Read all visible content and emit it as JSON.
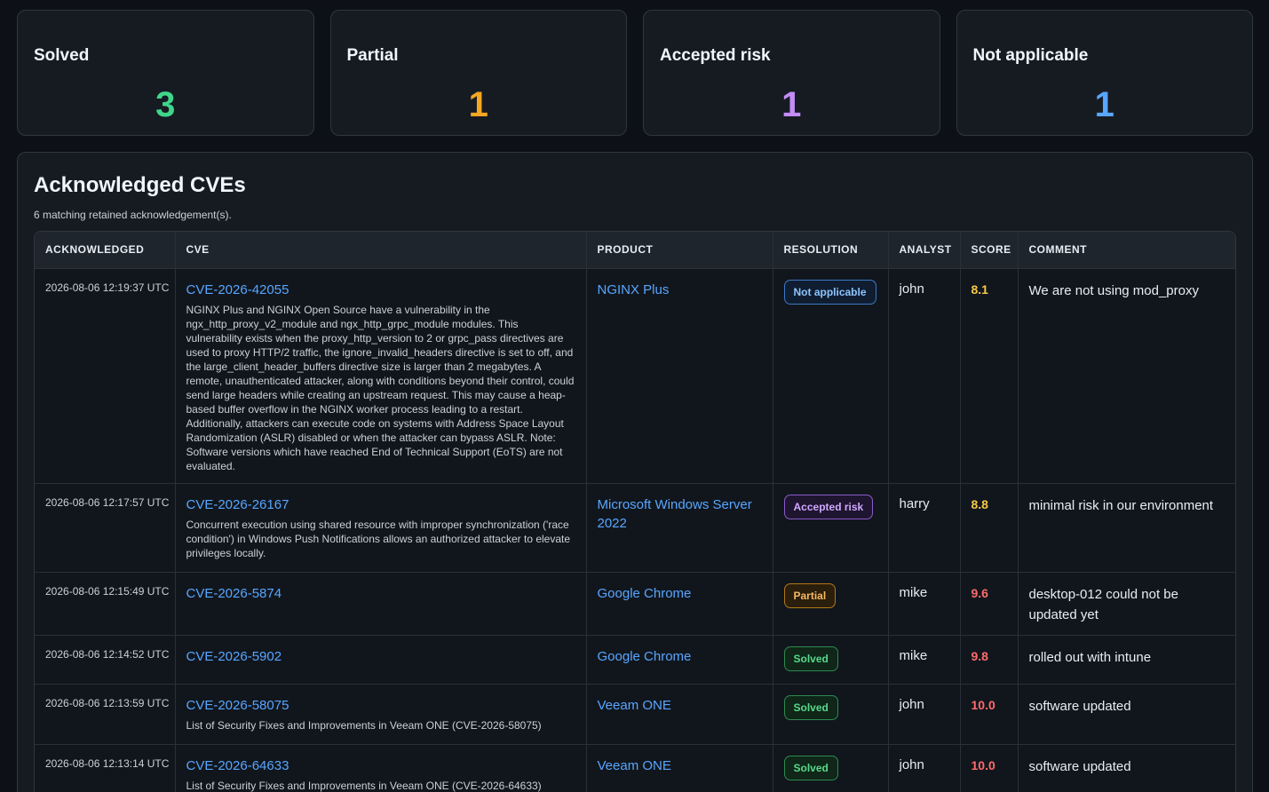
{
  "summary": {
    "cards": [
      {
        "label": "Solved",
        "value": "3",
        "color": "#3fd68a"
      },
      {
        "label": "Partial",
        "value": "1",
        "color": "#f5a623"
      },
      {
        "label": "Accepted risk",
        "value": "1",
        "color": "#c48cf7"
      },
      {
        "label": "Not applicable",
        "value": "1",
        "color": "#58a6ff"
      }
    ]
  },
  "panel": {
    "title": "Acknowledged CVEs",
    "subtitle": "6 matching retained acknowledgement(s)."
  },
  "table": {
    "headers": [
      "ACKNOWLEDGED",
      "CVE",
      "PRODUCT",
      "RESOLUTION",
      "ANALYST",
      "SCORE",
      "COMMENT"
    ],
    "rows": [
      {
        "acknowledged": "2026-08-06 12:19:37 UTC",
        "cve": "CVE-2026-42055",
        "description": "NGINX Plus and NGINX Open Source have a vulnerability in the ngx_http_proxy_v2_module and ngx_http_grpc_module modules. This vulnerability exists when the proxy_http_version to 2 or grpc_pass directives are used to proxy HTTP/2 traffic, the ignore_invalid_headers directive is set to off, and the large_client_header_buffers directive size is larger than 2 megabytes. A remote, unauthenticated attacker, along with conditions beyond their control, could send large headers while creating an upstream request. This may cause a heap-based buffer overflow in the NGINX worker process leading to a restart. Additionally, attackers can execute code on systems with Address Space Layout Randomization (ASLR) disabled or when the attacker can bypass ASLR. Note: Software versions which have reached End of Technical Support (EoTS) are not evaluated.",
        "product": "NGINX Plus",
        "resolution": "Not applicable",
        "analyst": "john",
        "score": "8.1",
        "comment": "We are not using mod_proxy"
      },
      {
        "acknowledged": "2026-08-06 12:17:57 UTC",
        "cve": "CVE-2026-26167",
        "description": "Concurrent execution using shared resource with improper synchronization ('race condition') in Windows Push Notifications allows an authorized attacker to elevate privileges locally.",
        "product": "Microsoft Windows Server 2022",
        "resolution": "Accepted risk",
        "analyst": "harry",
        "score": "8.8",
        "comment": "minimal risk in our environment"
      },
      {
        "acknowledged": "2026-08-06 12:15:49 UTC",
        "cve": "CVE-2026-5874",
        "description": "",
        "product": "Google Chrome",
        "resolution": "Partial",
        "analyst": "mike",
        "score": "9.6",
        "comment": "desktop-012 could not be updated yet"
      },
      {
        "acknowledged": "2026-08-06 12:14:52 UTC",
        "cve": "CVE-2026-5902",
        "description": "",
        "product": "Google Chrome",
        "resolution": "Solved",
        "analyst": "mike",
        "score": "9.8",
        "comment": "rolled out with intune"
      },
      {
        "acknowledged": "2026-08-06 12:13:59 UTC",
        "cve": "CVE-2026-58075",
        "description": "List of Security Fixes and Improvements in Veeam ONE (CVE-2026-58075)",
        "product": "Veeam ONE",
        "resolution": "Solved",
        "analyst": "john",
        "score": "10.0",
        "comment": "software updated"
      },
      {
        "acknowledged": "2026-08-06 12:13:14 UTC",
        "cve": "CVE-2026-64633",
        "description": "List of Security Fixes and Improvements in Veeam ONE (CVE-2026-64633)",
        "product": "Veeam ONE",
        "resolution": "Solved",
        "analyst": "john",
        "score": "10.0",
        "comment": "software updated"
      }
    ]
  }
}
